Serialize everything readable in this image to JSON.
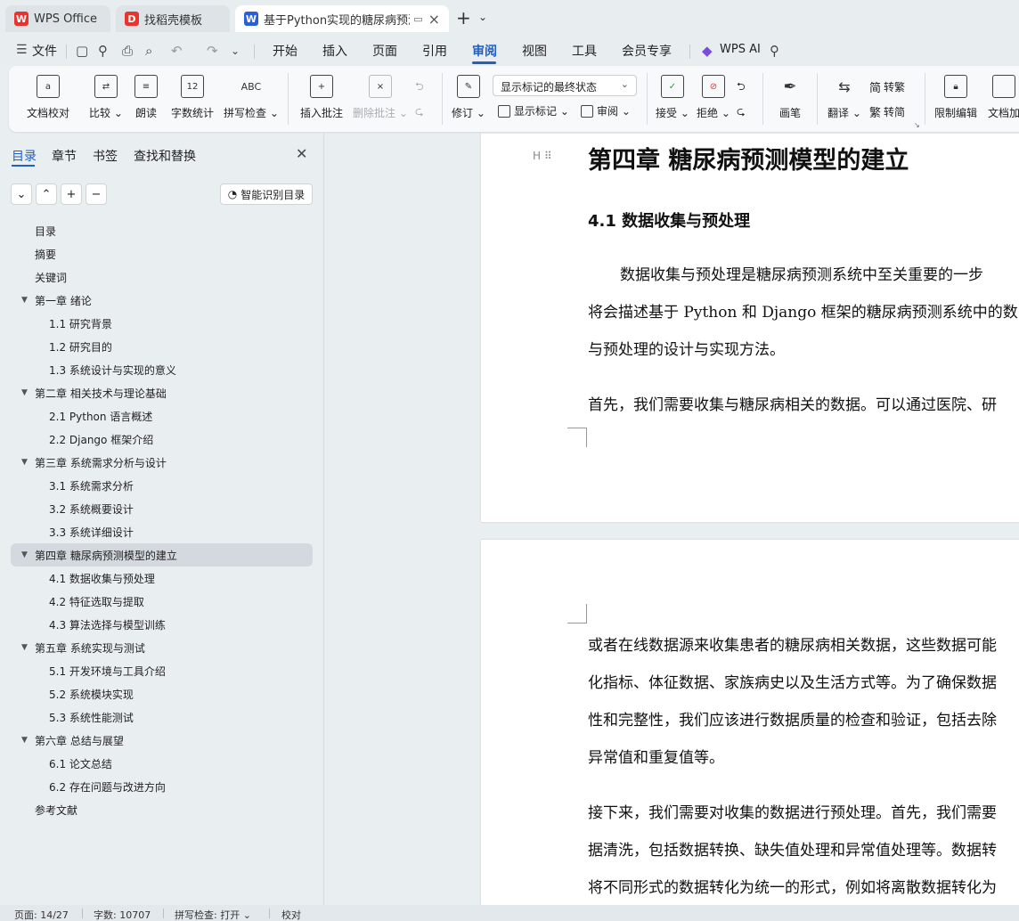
{
  "tabs": [
    {
      "label": "WPS Office",
      "logo": "W"
    },
    {
      "label": "找稻壳模板",
      "logo": "D"
    },
    {
      "label": "基于Python实现的糖尿病预测",
      "logo": "W"
    }
  ],
  "menu": {
    "file": "文件",
    "items": [
      "开始",
      "插入",
      "页面",
      "引用",
      "审阅",
      "视图",
      "工具",
      "会员专享"
    ],
    "active": "审阅",
    "ai": "WPS AI"
  },
  "ribbon": {
    "buttons": {
      "doc_check": "文档校对",
      "compare": "比较",
      "read_aloud": "朗读",
      "word_count": "字数统计",
      "spell_check": "拼写检查",
      "insert_comment": "插入批注",
      "delete_comment": "删除批注",
      "track": "修订",
      "show_markup": "显示标记",
      "review": "审阅",
      "accept": "接受",
      "reject": "拒绝",
      "pen": "画笔",
      "translate": "翻译",
      "to_traditional": "转繁",
      "to_simplified": "转简",
      "restrict_edit": "限制编辑",
      "doc_encrypt": "文档加"
    },
    "display_state": "显示标记的最终状态",
    "word_count_icon_text": "12",
    "spell_icon_text": "ABC"
  },
  "nav": {
    "tabs": [
      "目录",
      "章节",
      "书签",
      "查找和替换"
    ],
    "smart_toc": "智能识别目录",
    "toc": [
      {
        "label": "目录",
        "level": 0
      },
      {
        "label": "摘要",
        "level": 0
      },
      {
        "label": "关键词",
        "level": 0
      },
      {
        "label": "第一章  绪论",
        "level": 1
      },
      {
        "label": "1.1  研究背景",
        "level": 2
      },
      {
        "label": "1.2  研究目的",
        "level": 2
      },
      {
        "label": "1.3  系统设计与实现的意义",
        "level": 2
      },
      {
        "label": "第二章  相关技术与理论基础",
        "level": 1
      },
      {
        "label": "2.1 Python 语言概述",
        "level": 2
      },
      {
        "label": "2.2 Django 框架介绍",
        "level": 2
      },
      {
        "label": "第三章  系统需求分析与设计",
        "level": 1
      },
      {
        "label": "3.1  系统需求分析",
        "level": 2
      },
      {
        "label": "3.2  系统概要设计",
        "level": 2
      },
      {
        "label": "3.3  系统详细设计",
        "level": 2
      },
      {
        "label": "第四章  糖尿病预测模型的建立",
        "level": 1,
        "selected": true
      },
      {
        "label": "4.1  数据收集与预处理",
        "level": 2
      },
      {
        "label": "4.2  特征选取与提取",
        "level": 2
      },
      {
        "label": "4.3  算法选择与模型训练",
        "level": 2
      },
      {
        "label": "第五章  系统实现与测试",
        "level": 1
      },
      {
        "label": "5.1  开发环境与工具介绍",
        "level": 2
      },
      {
        "label": "5.2  系统模块实现",
        "level": 2
      },
      {
        "label": "5.3  系统性能测试",
        "level": 2
      },
      {
        "label": "第六章  总结与展望",
        "level": 1
      },
      {
        "label": "6.1  论文总结",
        "level": 2
      },
      {
        "label": "6.2  存在问题与改进方向",
        "level": 2
      },
      {
        "label": "参考文献",
        "level": 0
      }
    ]
  },
  "doc": {
    "heading_marker": "H",
    "chapter_title": "第四章  糖尿病预测模型的建立",
    "section_title": "4.1  数据收集与预处理",
    "page1_lines": [
      "数据收集与预处理是糖尿病预测系统中至关重要的一步",
      "将会描述基于 Python 和 Django 框架的糖尿病预测系统中的数",
      "与预处理的设计与实现方法。",
      "首先，我们需要收集与糖尿病相关的数据。可以通过医院、研"
    ],
    "page2_lines": [
      "或者在线数据源来收集患者的糖尿病相关数据，这些数据可能",
      "化指标、体征数据、家族病史以及生活方式等。为了确保数据",
      "性和完整性，我们应该进行数据质量的检查和验证，包括去除",
      "异常值和重复值等。",
      "接下来，我们需要对收集的数据进行预处理。首先，我们需要",
      "据清洗，包括数据转换、缺失值处理和异常值处理等。数据转",
      "将不同形式的数据转化为统一的形式，例如将离散数据转化为"
    ]
  },
  "status": {
    "page": "页面: 14/27",
    "words": "字数: 10707",
    "spell": "拼写检查: 打开",
    "proof": "校对"
  }
}
